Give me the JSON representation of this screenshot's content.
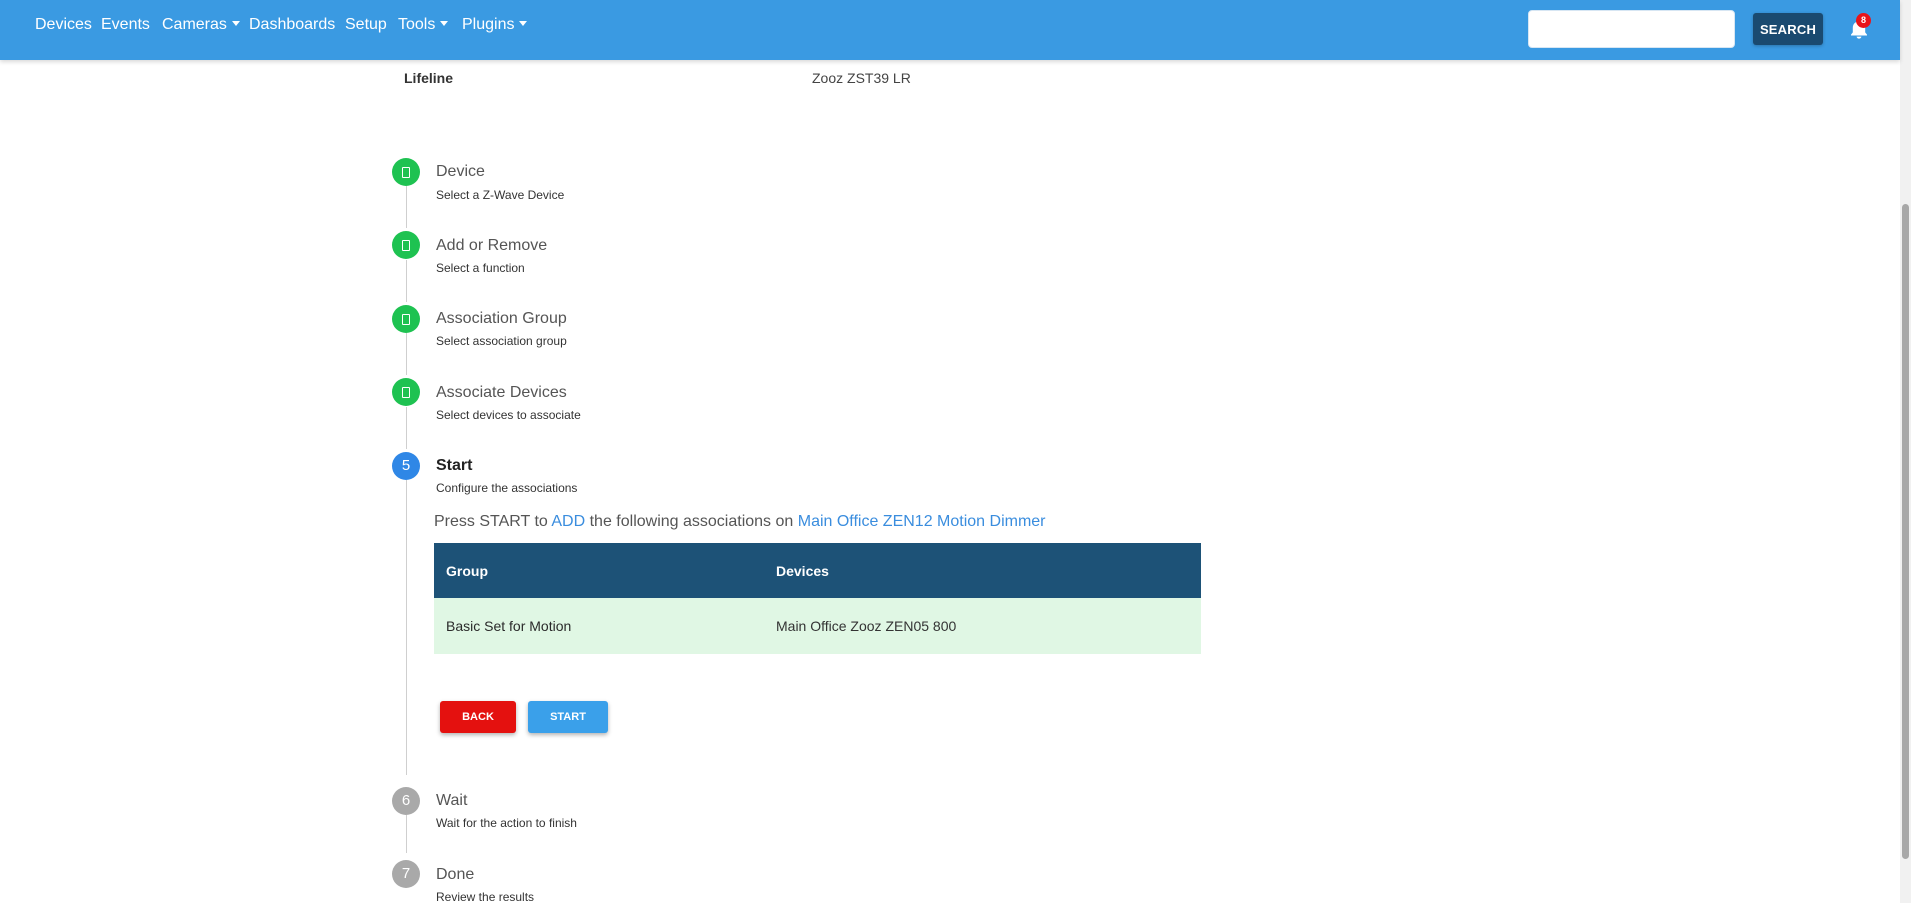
{
  "nav": {
    "items": [
      {
        "label": "Devices",
        "dropdown": false
      },
      {
        "label": "Events",
        "dropdown": false
      },
      {
        "label": "Cameras",
        "dropdown": true
      },
      {
        "label": "Dashboards",
        "dropdown": false
      },
      {
        "label": "Setup",
        "dropdown": false
      },
      {
        "label": "Tools",
        "dropdown": true
      },
      {
        "label": "Plugins",
        "dropdown": true
      }
    ],
    "search_value": "",
    "search_button": "SEARCH",
    "notification_count": "8"
  },
  "lifeline": {
    "label": "Lifeline",
    "value": "Zooz ZST39 LR"
  },
  "steps": [
    {
      "marker": "",
      "status": "done",
      "title": "Device",
      "subtitle": "Select a Z-Wave Device"
    },
    {
      "marker": "",
      "status": "done",
      "title": "Add or Remove",
      "subtitle": "Select a function"
    },
    {
      "marker": "",
      "status": "done",
      "title": "Association Group",
      "subtitle": "Select association group"
    },
    {
      "marker": "",
      "status": "done",
      "title": "Associate Devices",
      "subtitle": "Select devices to associate"
    },
    {
      "marker": "5",
      "status": "active",
      "title": "Start",
      "subtitle": "Configure the associations"
    },
    {
      "marker": "6",
      "status": "pending",
      "title": "Wait",
      "subtitle": "Wait for the action to finish"
    },
    {
      "marker": "7",
      "status": "pending",
      "title": "Done",
      "subtitle": "Review the results"
    }
  ],
  "instruction": {
    "prefix": "Press START to ",
    "action": "ADD",
    "middle": " the following associations on ",
    "device": "Main Office ZEN12 Motion Dimmer"
  },
  "table": {
    "headers": [
      "Group",
      "Devices"
    ],
    "rows": [
      [
        "Basic Set for Motion",
        "Main Office Zooz ZEN05 800"
      ]
    ]
  },
  "buttons": {
    "back": "BACK",
    "start": "START"
  },
  "colors": {
    "navbar": "#3a9ae2",
    "step_done": "#1ec251",
    "step_active": "#2f87e6",
    "step_pending": "#a9a9a9",
    "table_header": "#1d5277",
    "table_row": "#e0f7e4",
    "back_button": "#e4110f",
    "start_button": "#3aa0ea",
    "link": "#3a8dde"
  }
}
